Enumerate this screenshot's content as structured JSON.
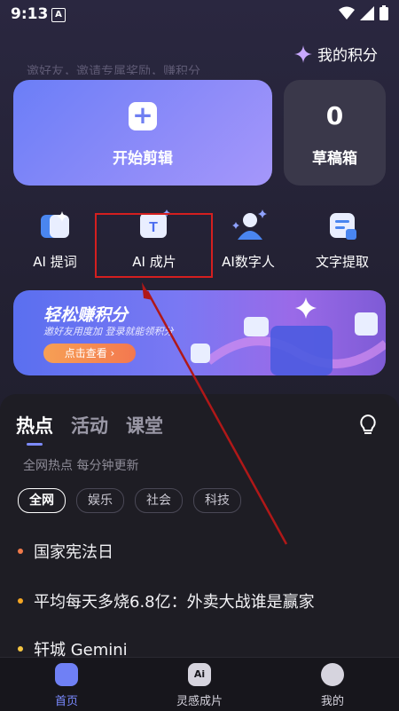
{
  "status_bar": {
    "time": "9:13",
    "notif_icon_label": "A"
  },
  "header": {
    "points_label": "我的积分",
    "marquee_text": "邀好友，邀请专属奖励，赚积分"
  },
  "create_card": {
    "label": "开始剪辑",
    "icon": "plus-icon"
  },
  "draft_card": {
    "count": "0",
    "label": "草稿箱"
  },
  "tools": [
    {
      "label": "AI 提词",
      "icon": "ai-prompt-icon"
    },
    {
      "label": "AI 成片",
      "icon": "ai-video-icon"
    },
    {
      "label": "AI数字人",
      "icon": "digital-human-icon"
    },
    {
      "label": "文字提取",
      "icon": "text-extract-icon"
    }
  ],
  "banner": {
    "title": "轻松赚积分",
    "subtitle": "邀好友用度加 登录就能领积分",
    "cta": "点击查看 ›"
  },
  "feed": {
    "tabs": [
      "热点",
      "活动",
      "课堂"
    ],
    "subtitle": "全网热点 每分钟更新",
    "chips": [
      "全网",
      "娱乐",
      "社会",
      "科技"
    ],
    "items": [
      {
        "text": "国家宪法日",
        "dot_color": "#f07a4a"
      },
      {
        "text": "平均每天多烧6.8亿：外卖大战谁是赢家",
        "dot_color": "#f5a623"
      },
      {
        "text": "轩城 Gemini",
        "dot_color": "#f5c542"
      }
    ]
  },
  "bottom_nav": [
    {
      "label": "首页",
      "icon": "home-icon"
    },
    {
      "label": "灵感成片",
      "icon": "inspiration-icon"
    },
    {
      "label": "我的",
      "icon": "profile-icon"
    }
  ],
  "colors": {
    "accent": "#7a8aff",
    "highlight": "#d41f1f",
    "arrow": "#b01818"
  }
}
